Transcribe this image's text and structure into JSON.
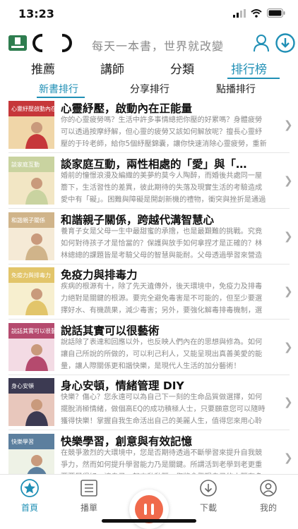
{
  "status_bar": {
    "time": "13:23"
  },
  "header": {
    "slogan": "每天一本書，世界就改變"
  },
  "main_tabs": [
    {
      "label": "推薦"
    },
    {
      "label": "講師"
    },
    {
      "label": "分類"
    },
    {
      "label": "排行榜"
    }
  ],
  "sub_tabs": [
    {
      "label": "新書排行"
    },
    {
      "label": "分享排行"
    },
    {
      "label": "點播排行"
    }
  ],
  "items": [
    {
      "title": "心靈紓壓，啟動內在正能量",
      "desc": "你的心靈疲勞嗎？生活中許多事情總把你壓的好累嗎？身體疲勞可以透過按摩紓解，但心靈的疲勞又該如何解放呢？擅長心靈紓壓的于玲老師，給你5個紓壓錦囊，讓你快速消除心靈疲勞，重新啟動內在正能量！",
      "cover_text": "心靈紓壓啟動內在正能量",
      "cover_colors": [
        "#c6373a",
        "#f0d6a8"
      ]
    },
    {
      "title": "談家庭互動，兩性相處的「愛」與「…",
      "desc": "婚前的憧憬浪漫及編織的美夢約莫今人陶醉，而婚後共處同一屋簷下，生活習性的差異，彼此期待的失落及現實生活的考驗造成愛中有「礙」。困難與障礙是開創新機的禮物，衝突與挫折是通過迷霧與鐵障的過程，而接納包容與愛心是…",
      "cover_text": "談家庭互動",
      "cover_colors": [
        "#c9d3a0",
        "#f2e6c4"
      ]
    },
    {
      "title": "和諧親子關係，跨越代溝智慧心",
      "desc": "養育子女是父母一生中最甜蜜的承擔，也是最艱難的挑戰。究竟如何對待孩子才是恰當的？保護與放手如何拿捏才是正確的？林林總總的課題皆是考驗父母的智慧與能耐。父母透過學習來營造使孩子良好成長的環境，讓出空間提供孩子…",
      "cover_text": "和諧親子關係",
      "cover_colors": [
        "#d0b48a",
        "#f5ead6"
      ]
    },
    {
      "title": "免疫力與排毒力",
      "desc": "疾病的根源有十，除了先天遺傳外，後天環境中，免疫力及排毒力絕對是關鍵的根源。要完全避免毒害是不可能的，但至少要選擇好水、有機蔬果，減少毒害；另外，要強化解毒排毒機制，選擇適當蔬果，調節免疫力，排除自由基，介…",
      "cover_text": "免疫力與排毒力",
      "cover_colors": [
        "#e2c56a",
        "#f7efcf"
      ]
    },
    {
      "title": "說話其實可以很藝術",
      "desc": "說話除了表達和回應以外，也反映人們內在的思想與修為。如何讓自己所說的所做的，可以利己利人，又能呈現出真善美愛的能量，讓人際關係更和諧快樂，是現代人生活的加分藝術！",
      "cover_text": "說話其實可以很藝術",
      "cover_colors": [
        "#b54a6e",
        "#f3dbe4"
      ]
    },
    {
      "title": "身心安頓，情緒管理 DIY",
      "desc": "快樂？傷心？您永遠可以為自己下一刻的生命品質做選擇，如何擺脫消極情緒，做個高EQ的成功積極人士，只要願意您可以隨時獲得快樂！掌握自我生命活出自己的美麗人生，值得您來用心聆聽。",
      "cover_text": "身心安頓",
      "cover_colors": [
        "#3c3a52",
        "#e8c7bc"
      ]
    },
    {
      "title": "快樂學習，創意與有效記憶",
      "desc": "在競爭激烈的大環境中，您是否期待透過不斷學習來提升自我競爭力，然而如何提升學習能力乃是關鍵。所謂活到老學到老更重要要學得好，讓自己一起來動動腦，您將會發現自己的大腦有多神奇",
      "cover_text": "快樂學習",
      "cover_colors": [
        "#5c7f9e",
        "#eef2e6"
      ]
    }
  ],
  "bottom_nav": [
    {
      "label": "首頁",
      "icon": "home-star-icon"
    },
    {
      "label": "播單",
      "icon": "playlist-icon"
    },
    {
      "label": "下載",
      "icon": "download-icon"
    },
    {
      "label": "我的",
      "icon": "profile-icon"
    }
  ],
  "colors": {
    "accent": "#1f8fb5",
    "player": "#f06a4c"
  }
}
